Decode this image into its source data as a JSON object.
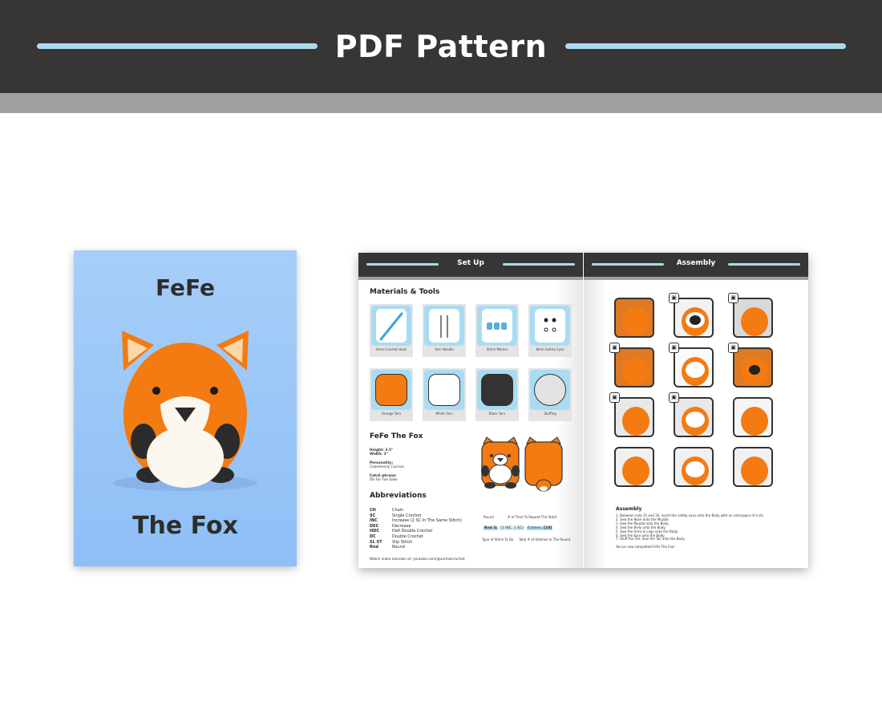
{
  "banner": {
    "title": "PDF Pattern"
  },
  "cover": {
    "line1": "FeFe",
    "line2": "The Fox"
  },
  "setup": {
    "header": "Set Up",
    "materials_heading": "Materials & Tools",
    "materials": [
      {
        "label": "4mm Crochet Hook",
        "icon": "crochet-hook-icon"
      },
      {
        "label": "Yarn Needle",
        "icon": "yarn-needle-icon"
      },
      {
        "label": "Stitch Marker",
        "icon": "stitch-marker-icon"
      },
      {
        "label": "8mm Safety Eyes",
        "icon": "safety-eyes-icon"
      },
      {
        "label": "Orange Yarn",
        "icon": "orange-yarn-swatch",
        "color": "#f47a12"
      },
      {
        "label": "White Yarn",
        "icon": "white-yarn-swatch",
        "color": "#ffffff"
      },
      {
        "label": "Black Yarn",
        "icon": "black-yarn-swatch",
        "color": "#333333"
      },
      {
        "label": "Stuffing",
        "icon": "stuffing-swatch",
        "color": "#e2e2e2"
      }
    ],
    "char_heading": "FeFe The Fox",
    "height": "Height: 3.5\"",
    "width": "Width: 3\"",
    "personality_label": "Personality:",
    "personality": "Ceaselessly Curious",
    "catch_label": "Catch phrase:",
    "catch": "Oh For Fox Sake",
    "abbr_heading": "Abbreviations",
    "abbreviations": [
      {
        "k": "CH",
        "v": "Chain"
      },
      {
        "k": "SC",
        "v": "Single Crochet"
      },
      {
        "k": "INC",
        "v": "Increase (2 SC In The Same Stitch)"
      },
      {
        "k": "DEC",
        "v": "Decrease"
      },
      {
        "k": "HDC",
        "v": "Half Double Crochet"
      },
      {
        "k": "DC",
        "v": "Double Crochet"
      },
      {
        "k": "SL ST",
        "v": "Slip Stitch"
      },
      {
        "k": "Rnd",
        "v": "Round"
      }
    ],
    "diagram": {
      "round": "Round",
      "repeat": "# of Time To Repeat The Stitch",
      "rnd": "Rnd 3:",
      "stitch": "(1 INC, 1 SC)",
      "times": "6 times.",
      "total": "[18]",
      "type": "Type of Stitch To Do",
      "total_label": "Total # of Stitches In The Round"
    },
    "video": "Watch video tutorials at: youtube.com/@animalcrochet"
  },
  "assembly": {
    "header": "Assembly",
    "heading": "Assembly",
    "steps": [
      "1. Between rnds 15 and 16, insert the safety eyes onto the Body with an interspace of 4 sts.",
      "2. Sew the Nose onto the Muzzle.",
      "3. Sew the Muzzle onto the Body.",
      "4. Sew the Belly onto the Body.",
      "5. Sew the Arms & Legs onto the Body.",
      "6. Sew the Ears onto the Body.",
      "7. Stuff the Tail. Sew the Tail onto the Body."
    ],
    "done": "You've now completed FeFe The Fox!"
  },
  "colors": {
    "banner": "#383634",
    "accent": "#a9dcf2",
    "fox_orange": "#f47a12"
  }
}
